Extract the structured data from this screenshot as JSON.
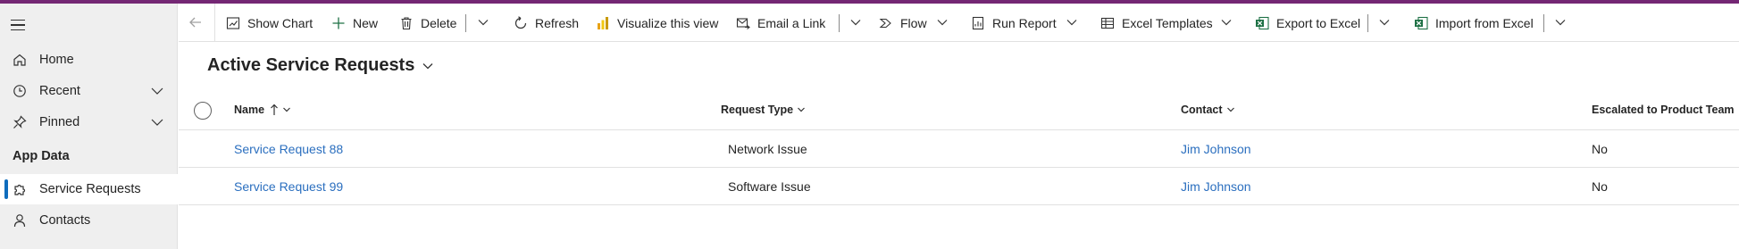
{
  "sidebar": {
    "items": [
      {
        "label": "Home",
        "icon": "home-icon"
      },
      {
        "label": "Recent",
        "icon": "clock-icon"
      },
      {
        "label": "Pinned",
        "icon": "pin-icon"
      }
    ],
    "section_title": "App Data",
    "app_items": [
      {
        "label": "Service Requests",
        "icon": "puzzle-icon",
        "selected": true
      },
      {
        "label": "Contacts",
        "icon": "person-icon",
        "selected": false
      }
    ]
  },
  "toolbar": {
    "show_chart": "Show Chart",
    "new": "New",
    "delete": "Delete",
    "refresh": "Refresh",
    "visualize": "Visualize this view",
    "email_link": "Email a Link",
    "flow": "Flow",
    "run_report": "Run Report",
    "excel_templates": "Excel Templates",
    "export_excel": "Export to Excel",
    "import_excel": "Import from Excel"
  },
  "view": {
    "title": "Active Service Requests"
  },
  "table": {
    "columns": [
      "Name",
      "Request Type",
      "Contact",
      "Escalated to Product Team"
    ],
    "rows": [
      {
        "name": "Service Request 88",
        "request_type": "Network Issue",
        "contact": "Jim Johnson",
        "escalated": "No"
      },
      {
        "name": "Service Request 99",
        "request_type": "Software Issue",
        "contact": "Jim Johnson",
        "escalated": "No"
      }
    ]
  },
  "colors": {
    "accent": "#742774",
    "link": "#2b6fbf",
    "selected_indicator": "#0f6cbd",
    "excel_green": "#1e7145"
  }
}
